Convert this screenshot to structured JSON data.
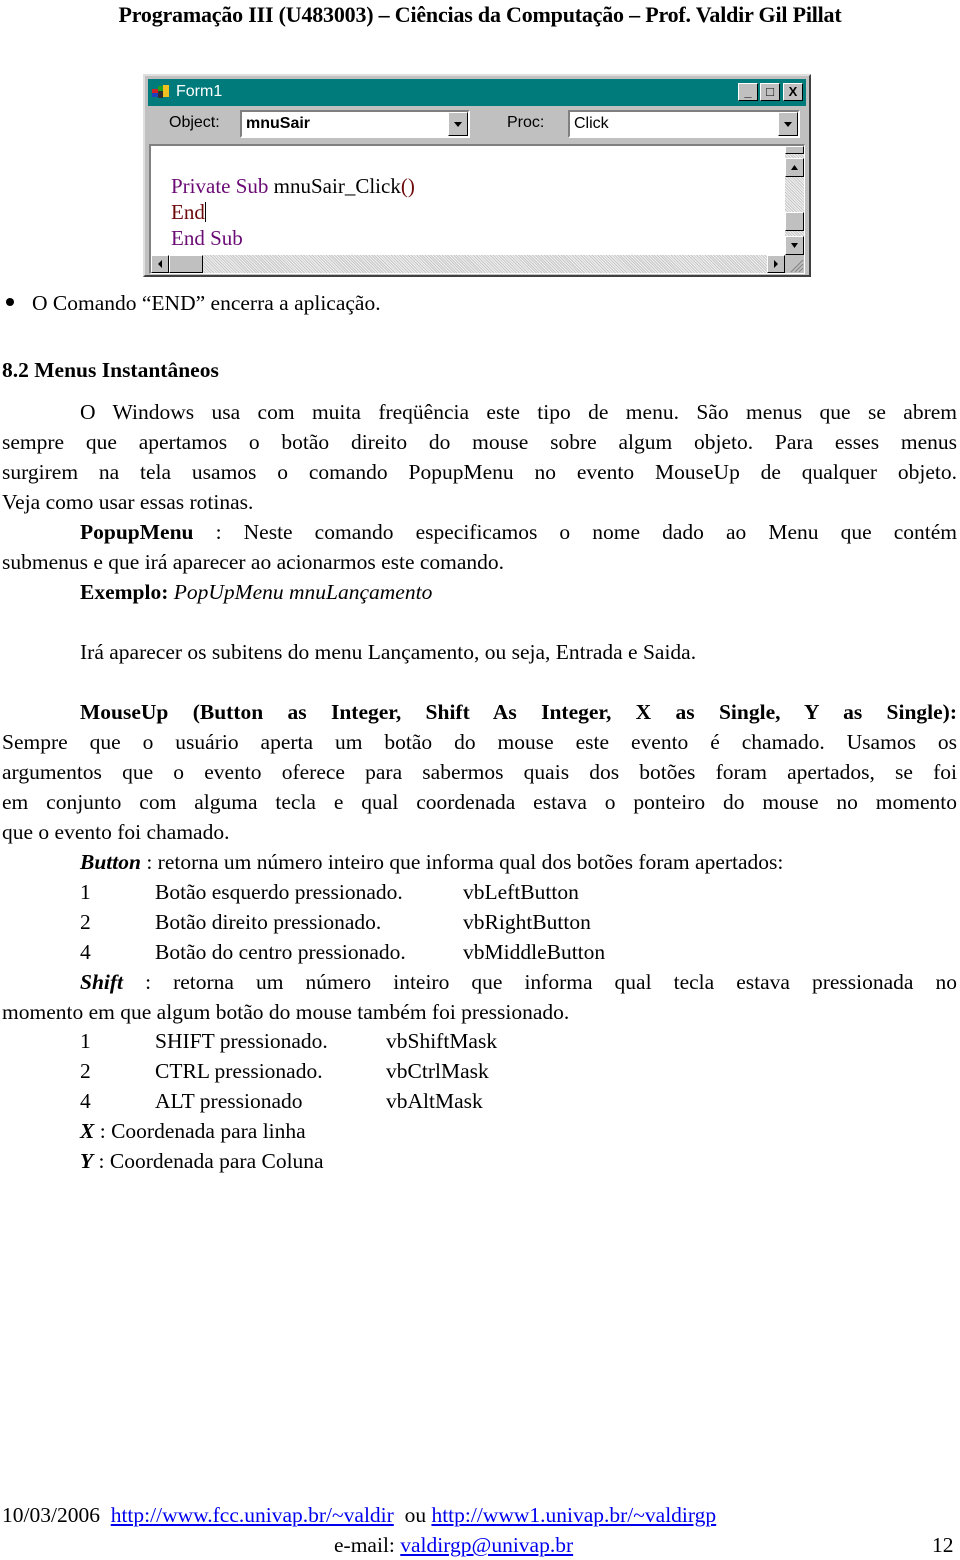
{
  "header": {
    "title": "Programação III (U483003) – Ciências da Computação – Prof. Valdir Gil Pillat"
  },
  "vb_window": {
    "title": "Form1",
    "controls": {
      "minimize": "_",
      "maximize": "□",
      "close": "X"
    },
    "object_label": "Object:",
    "object_value": "mnuSair",
    "proc_label": "Proc:",
    "proc_value": "Click",
    "code_lines": {
      "line1_kw": "Private Sub",
      "line1_rest": " mnuSair_Click",
      "line1_paren": "()",
      "line2": "End",
      "line3": "End Sub"
    },
    "colors": {
      "titlebar": "#007b7b",
      "keyword": "#6a0a74",
      "end_keyword": "#6d0a0a"
    }
  },
  "bullet_text": "O Comando “END” encerra a aplicação.",
  "section": {
    "heading": "8.2 Menus Instantâneos",
    "intro_lines": [
      "O Windows usa com muita freqüência este tipo de menu. São menus que se abrem",
      "sempre que apertamos o botão direito do mouse sobre algum objeto. Para esses menus",
      "surgirem na tela usamos o comando PopupMenu no evento MouseUp de qualquer objeto.",
      "Veja como usar essas rotinas."
    ],
    "popupmenu": {
      "term": "PopupMenu",
      "line1": " :  Neste comando especificamos o nome dado ao Menu que contém",
      "line2": "submenus e que irá aparecer ao acionarmos este comando."
    },
    "example": {
      "label": "Exemplo:",
      "code": "PopUpMenu mnuLançamento"
    },
    "example_note": "Irá aparecer os subitens do menu Lançamento, ou seja, Entrada e Saida.",
    "mouseup": {
      "signature": "MouseUp (Button as Integer, Shift As Integer, X as Single, Y as Single):",
      "lines": [
        "Sempre que o usuário aperta um botão do mouse este evento é chamado. Usamos os",
        "argumentos que o evento oferece para sabermos quais dos botões foram apertados, se foi",
        "em conjunto com alguma tecla e qual coordenada estava o ponteiro do mouse no momento",
        "que o evento foi chamado."
      ]
    },
    "button_param": {
      "term": "Button",
      "desc": " : retorna  um número inteiro que informa qual dos botões foram apertados:",
      "rows": [
        {
          "value": "1",
          "desc": "Botão esquerdo pressionado.",
          "const": "vbLeftButton"
        },
        {
          "value": "2",
          "desc": "Botão direito pressionado.",
          "const": "vbRightButton"
        },
        {
          "value": "4",
          "desc": "Botão do centro pressionado.",
          "const": "vbMiddleButton"
        }
      ]
    },
    "shift_param": {
      "term": "Shift",
      "line1": " : retorna um número inteiro que informa qual tecla estava pressionada no",
      "line2": "momento em que algum botão do mouse também foi pressionado.",
      "rows": [
        {
          "value": "1",
          "desc": "SHIFT pressionado.",
          "const": "vbShiftMask"
        },
        {
          "value": "2",
          "desc": "CTRL pressionado.",
          "const": "vbCtrlMask"
        },
        {
          "value": "4",
          "desc": "ALT pressionado",
          "const": "vbAltMask"
        }
      ]
    },
    "x_param": {
      "term": "X",
      "desc": " : Coordenada para linha"
    },
    "y_param": {
      "term": "Y",
      "desc": " : Coordenada para Coluna"
    }
  },
  "footer": {
    "date": "10/03/2006",
    "link1": "http://www.fcc.univap.br/~valdir",
    "or": "ou",
    "link2": "http://www1.univap.br/~valdirgp",
    "email_label": "e-mail:",
    "email": "valdirgp@univap.br",
    "page_number": "12"
  }
}
